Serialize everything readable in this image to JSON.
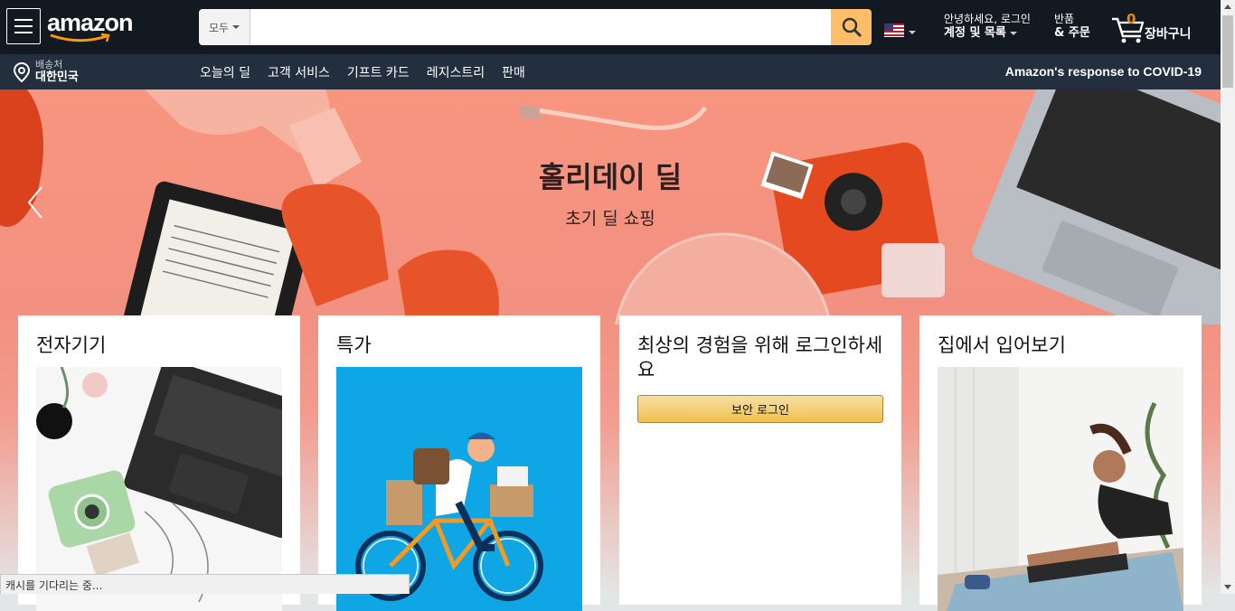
{
  "header": {
    "logo_text": "amazon",
    "search": {
      "category": "모두",
      "placeholder": ""
    },
    "account": {
      "greeting": "안녕하세요, 로그인",
      "label": "계정 및 목록"
    },
    "returns": {
      "line1": "반품",
      "line2": "& 주문"
    },
    "cart": {
      "count": "0",
      "label": "장바구니"
    },
    "colors": {
      "nav_bg": "#131921",
      "subnav_bg": "#232f3e",
      "search_button": "#febd69",
      "cart_count": "#f08804"
    }
  },
  "subnav": {
    "location": {
      "line1": "배송처",
      "line2": "대한민국"
    },
    "links": [
      "오늘의 딜",
      "고객 서비스",
      "기프트 카드",
      "레지스트리",
      "판매"
    ],
    "covid": "Amazon's response to COVID-19"
  },
  "hero": {
    "title": "홀리데이 딜",
    "subtitle": "초기 딜 쇼핑"
  },
  "cards": [
    {
      "title": "전자기기",
      "image": "laptop-camera-image"
    },
    {
      "title": "특가",
      "image": "delivery-bicycle-illustration"
    },
    {
      "title": "최상의 경험을 위해 로그인하세요",
      "button": "보안 로그인"
    },
    {
      "title": "집에서 입어보기",
      "image": "yoga-stretch-image"
    }
  ],
  "status_bar": "캐시를 기다리는 중..."
}
